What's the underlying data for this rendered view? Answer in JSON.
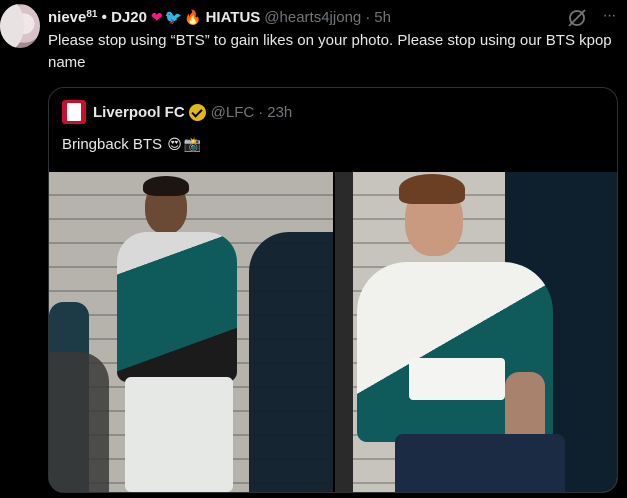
{
  "tweet": {
    "display_name": "nieve",
    "name_superscript": "81",
    "name_separator": "•",
    "name_suffix": "DJ20",
    "hiatus_label": "HIATUS",
    "handle": "@hearts4jjong",
    "dot": "·",
    "time": "5h",
    "text": "Please stop using “BTS” to gain likes on your photo. Please stop using our BTS kpop name"
  },
  "quote": {
    "display_name": "Liverpool FC",
    "handle": "@LFC",
    "dot": "·",
    "time": "23h",
    "text": "Bringback BTS"
  },
  "icons": {
    "heart": "red-heart-emoji",
    "bird": "red-bird-emoji",
    "fire": "fire-emoji",
    "verified": "gold-verified-badge",
    "grok": "grok-icon",
    "more": "more-icon",
    "heart_eyes": "heart-eyes-emoji",
    "camera": "camera-flash-emoji"
  },
  "emoji": {
    "heart": "❤",
    "bird": "🐦",
    "fire": "🔥",
    "heart_eyes": "😍",
    "camera": "📸",
    "more": "···"
  },
  "colors": {
    "background": "#000000",
    "text": "#e7e9ea",
    "secondary": "#71767b",
    "border": "#2f3336",
    "verified_gold": "#e2b719",
    "lfc_red": "#c8102e",
    "jacket_teal": "#0f5b5b"
  }
}
